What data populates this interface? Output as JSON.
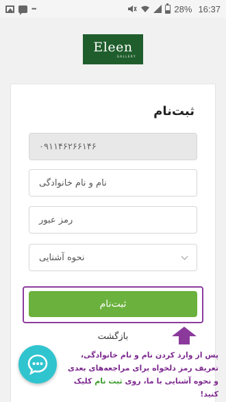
{
  "status_bar": {
    "battery": "28%",
    "time": "16:37"
  },
  "logo": {
    "word": "Eleen",
    "sub": "GALLERY"
  },
  "form": {
    "title": "ثبت‌نام",
    "phone_value": "۰۹۱۱۴۶۲۶۶۱۴۶",
    "name_placeholder": "نام و نام خانوادگی",
    "password_placeholder": "رمز عبور",
    "acquaintance_label": "نحوه آشنایی",
    "submit_label": "ثبت‌نام",
    "back_label": "بازگشت"
  },
  "instruction": {
    "part1": "پس از وارد کردن نام و نام خانوادگی، تعریف رمز دلخواه برای مراجعه‌های بعدی و نحوه آشنایی با ما، روی ",
    "highlight": "ثبت نام",
    "part2": " کلیک کنید!"
  },
  "colors": {
    "accent": "#6bb13d",
    "annotation": "#7d2a8f",
    "chat": "#30c4cf",
    "logo_bg": "#1f5e2c"
  },
  "icons": [
    "image-icon",
    "message-icon",
    "more-icon",
    "mute-icon",
    "wifi-icon",
    "signal-icon",
    "battery-icon",
    "chevron-down-icon",
    "chat-icon",
    "arrow-up-icon"
  ]
}
